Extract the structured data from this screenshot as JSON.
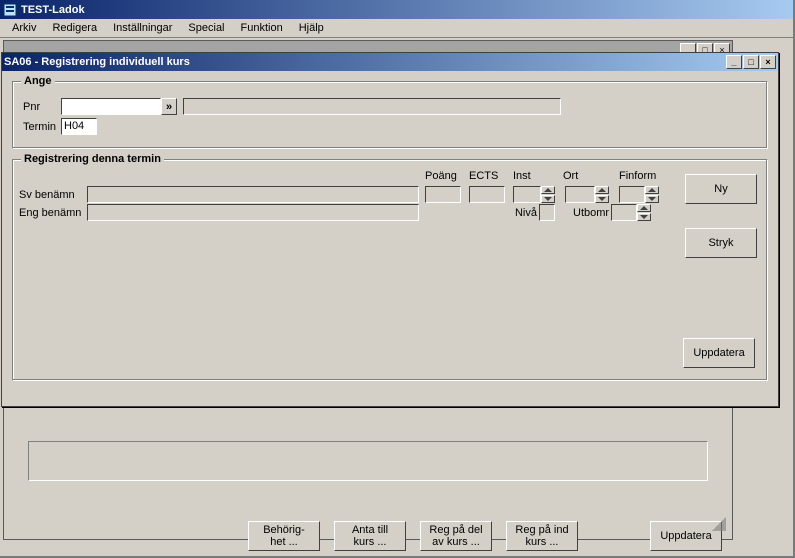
{
  "app": {
    "title": "TEST-Ladok"
  },
  "menubar": [
    "Arkiv",
    "Redigera",
    "Inställningar",
    "Special",
    "Funktion",
    "Hjälp"
  ],
  "back_window": {
    "buttons": {
      "behorig": "Behörig-\nhet ...",
      "anta": "Anta till\nkurs ...",
      "regdel": "Reg på del\nav kurs ...",
      "regind": "Reg på ind\nkurs ...",
      "uppdatera": "Uppdatera"
    },
    "winctrls": {
      "min": "_",
      "max": "□",
      "close": "×"
    }
  },
  "front_window": {
    "title": "SA06 - Registrering individuell kurs",
    "winctrls": {
      "min": "_",
      "max": "□",
      "close": "×"
    },
    "group_ange": {
      "legend": "Ange",
      "pnr_label": "Pnr",
      "pnr_value": "",
      "drop_label": "»",
      "name_value": "",
      "termin_label": "Termin",
      "termin_value": "H04"
    },
    "group_reg": {
      "legend": "Registrering denna termin",
      "cols": {
        "poang": "Poäng",
        "ects": "ECTS",
        "inst": "Inst",
        "ort": "Ort",
        "finform": "Finform"
      },
      "sv_label": "Sv benämn",
      "eng_label": "Eng benämn",
      "niva_label": "Nivå",
      "utbomr_label": "Utbomr",
      "buttons": {
        "ny": "Ny",
        "stryk": "Stryk",
        "uppdatera": "Uppdatera"
      }
    }
  }
}
